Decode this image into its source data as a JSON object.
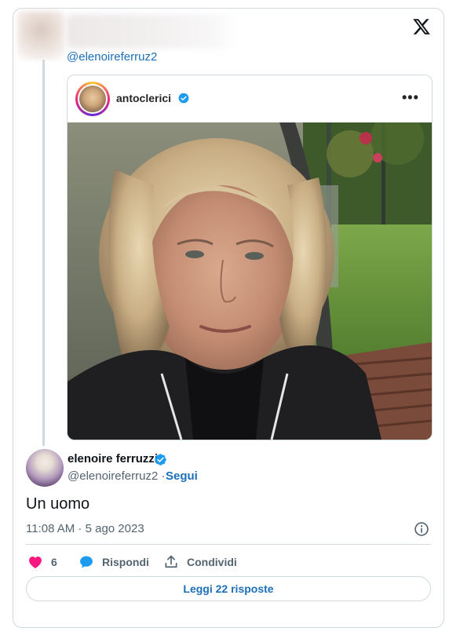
{
  "quoted_tweet": {
    "reply_to_handle": "@elenoireferruz2"
  },
  "instagram_embed": {
    "username": "antoclerici",
    "more_label": "•••"
  },
  "tweet": {
    "author_name": "elenoire ferruzzi",
    "author_handle": "@elenoireferruz2",
    "separator": " · ",
    "follow_label": "Segui",
    "text": "Un uomo",
    "timestamp": "11:08 AM · 5 ago 2023",
    "likes_count": "6",
    "reply_label": "Rispondi",
    "share_label": "Condividi",
    "read_replies_label": "Leggi 22 risposte"
  },
  "colors": {
    "link": "#1d6fb8",
    "verified": "#1d9bf0",
    "like": "#f91880",
    "border": "#cfd9de",
    "muted": "#536471"
  },
  "icons": [
    "x-logo-icon",
    "verified-badge-icon",
    "more-icon",
    "heart-icon",
    "reply-bubble-icon",
    "share-icon",
    "info-icon"
  ]
}
